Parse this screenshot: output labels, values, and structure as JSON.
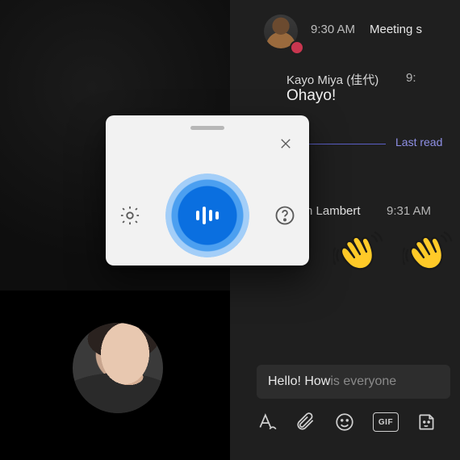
{
  "chat": {
    "msg1": {
      "time": "9:30 AM",
      "subject": "Meeting s"
    },
    "msg2": {
      "name": "Kayo Miya (佳代)",
      "time": "9:",
      "body": "Ohayo!"
    },
    "last_read": "Last read",
    "msg3": {
      "name_fragment": "n Lambert",
      "time": "9:31 AM"
    }
  },
  "compose": {
    "typed": "Hello! How ",
    "suggestion": "is everyone",
    "toolbar": {
      "gif_label": "GIF"
    }
  },
  "dictation": {
    "settings_icon": "gear-icon",
    "help_icon": "question-icon",
    "close_icon": "close-icon",
    "mic_icon": "dictate-mic-icon"
  }
}
